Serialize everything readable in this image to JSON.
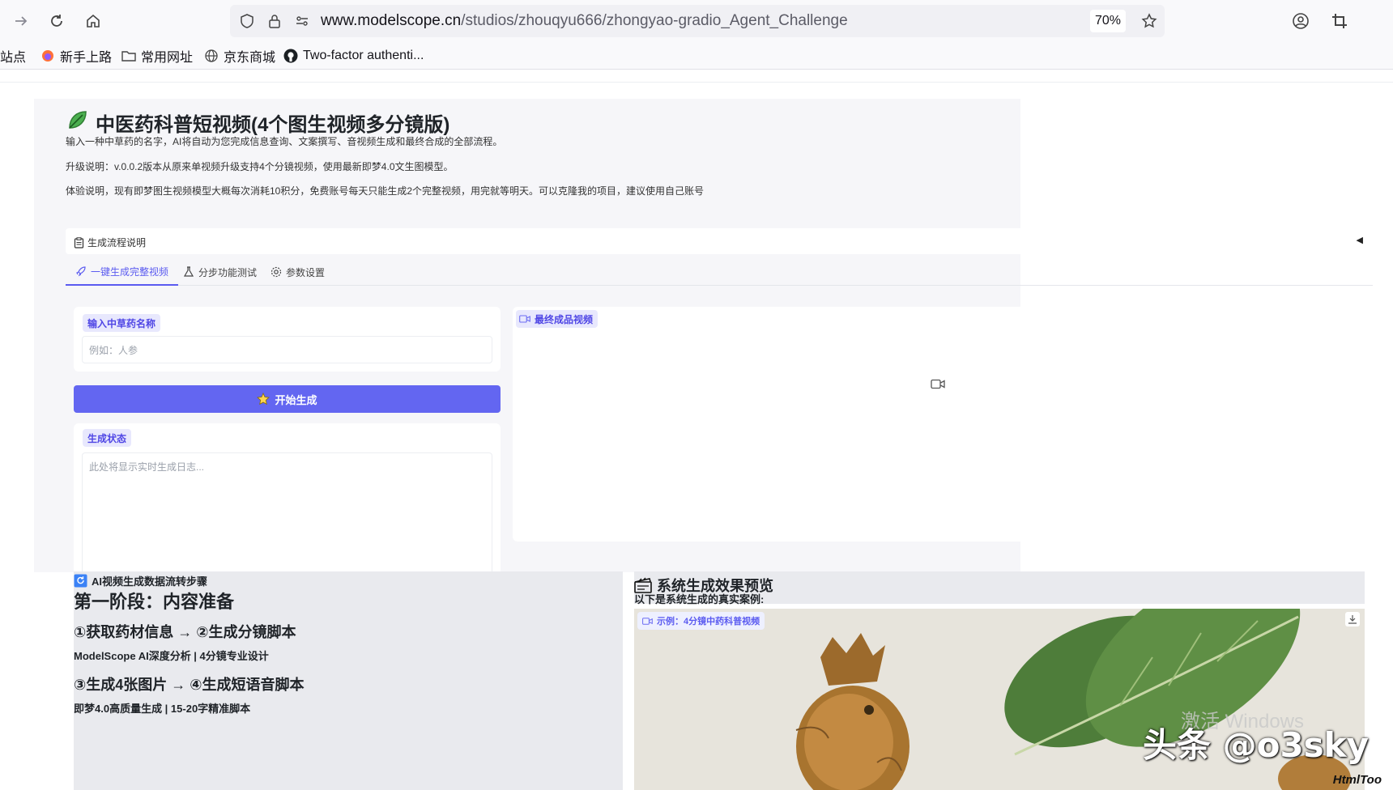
{
  "browser": {
    "url_domain": "www.modelscope.cn",
    "url_path": "/studios/zhouqyu666/zhongyao-gradio_Agent_Challenge",
    "zoom": "70%",
    "bookmarks": [
      "站点",
      "新手上路",
      "常用网址",
      "京东商城",
      "Two-factor authenti..."
    ]
  },
  "app": {
    "title": "中医药科普短视频(4个图生视频多分镜版)",
    "desc1": "输入一种中草药的名字，AI将自动为您完成信息查询、文案撰写、音视频生成和最终合成的全部流程。",
    "desc2": "升级说明：v.0.0.2版本从原来单视频升级支持4个分镜视频，使用最新即梦4.0文生图模型。",
    "desc3": "体验说明，现有即梦图生视频模型大概每次消耗10积分，免费账号每天只能生成2个完整视频，用完就等明天。可以克隆我的项目，建议使用自己账号",
    "accordion_label": "生成流程说明",
    "tabs": [
      "一键生成完整视频",
      "分步功能测试",
      "参数设置"
    ],
    "input_label": "输入中草药名称",
    "input_placeholder": "例如：人参",
    "generate_button": "开始生成",
    "status_label": "生成状态",
    "status_placeholder": "此处将显示实时生成日志...",
    "video_label": "最终成品视频"
  },
  "workflow": {
    "heading": "AI视频生成数据流转步骤",
    "stage": "第一阶段：内容准备",
    "step12": "①获取药材信息 → ②生成分镜脚本",
    "step12_desc": "ModelScope AI深度分析 | 4分镜专业设计",
    "step34": "③生成4张图片 → ④生成短语音脚本",
    "step34_desc": "即梦4.0高质量生成 | 15-20字精准脚本"
  },
  "preview": {
    "heading": "系统生成效果预览",
    "sub": "以下是系统生成的真实案例:",
    "example_label": "示例：4分镜中药科普视频"
  },
  "overlay": {
    "watermark": "头条 @o3sky",
    "watermark2": "HtmlToo",
    "windows": "激活 Windows"
  }
}
